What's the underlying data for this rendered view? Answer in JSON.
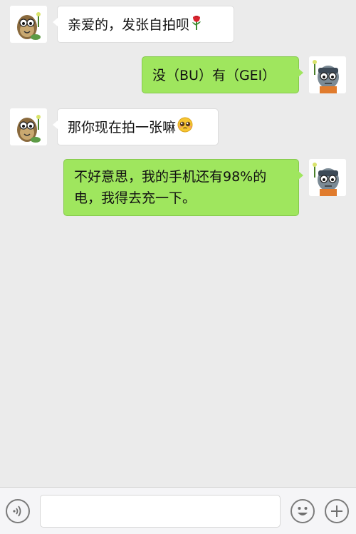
{
  "messages": [
    {
      "sender": "other",
      "text": "亲爱的，发张自拍呗",
      "emoji": "rose"
    },
    {
      "sender": "me",
      "text": "没（BU）有（GEI）"
    },
    {
      "sender": "other",
      "text": "那你现在拍一张嘛",
      "emoji": "pleading-face"
    },
    {
      "sender": "me",
      "text_line1": "不好意思，我的手机还有98%的",
      "text_line2": "电，我得去充一下。"
    }
  ],
  "input_bar": {
    "voice_icon": "voice-icon",
    "message_value": "",
    "emoji_icon": "smiley-icon",
    "more_icon": "plus-icon"
  },
  "colors": {
    "background": "#ebebeb",
    "incoming_bubble": "#ffffff",
    "outgoing_bubble": "#9fe65e",
    "input_bar": "#f5f5f7"
  }
}
